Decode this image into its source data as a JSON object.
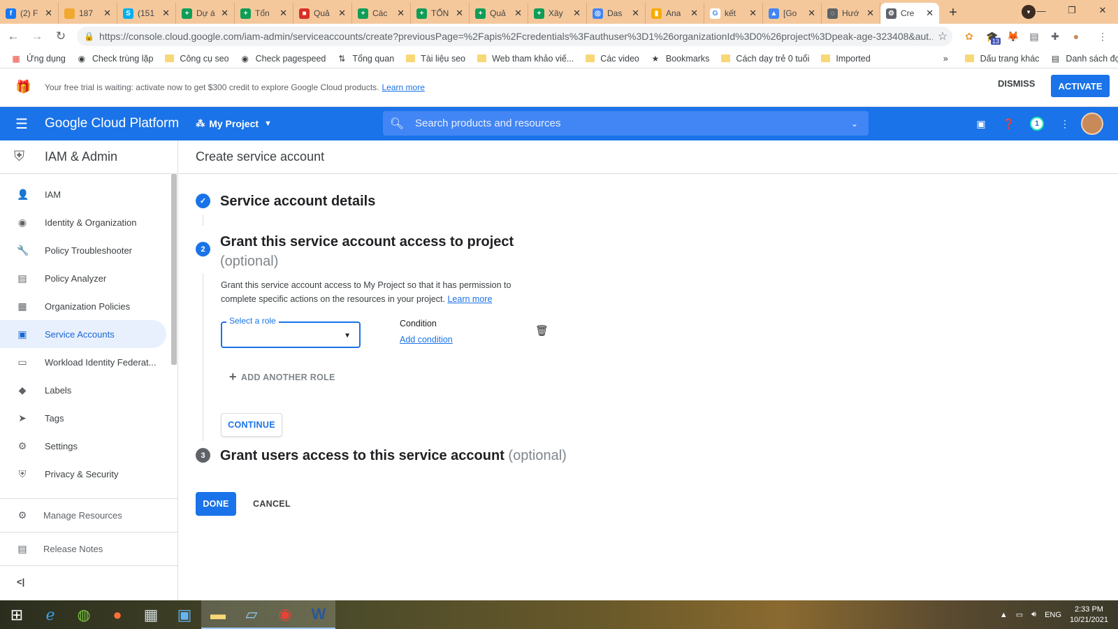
{
  "browser": {
    "tabs": [
      {
        "label": "(2) F",
        "icon": "facebook-icon",
        "color": "#1877f2",
        "glyph": "f"
      },
      {
        "label": "187",
        "icon": "tab-icon",
        "color": "#f0a830",
        "glyph": ""
      },
      {
        "label": "(151",
        "icon": "skype-icon",
        "color": "#00aff0",
        "glyph": "S"
      },
      {
        "label": "Dự á",
        "icon": "sheets-icon",
        "color": "#0f9d58",
        "glyph": "+"
      },
      {
        "label": "Tổn",
        "icon": "sheets-icon",
        "color": "#0f9d58",
        "glyph": "+"
      },
      {
        "label": "Quả",
        "icon": "slides-icon",
        "color": "#d93025",
        "glyph": "■"
      },
      {
        "label": "Các",
        "icon": "sheets-icon",
        "color": "#0f9d58",
        "glyph": "+"
      },
      {
        "label": "TỔN",
        "icon": "sheets-icon",
        "color": "#0f9d58",
        "glyph": "+"
      },
      {
        "label": "Quả",
        "icon": "sheets-icon",
        "color": "#0f9d58",
        "glyph": "+"
      },
      {
        "label": "Xây",
        "icon": "sheets-icon",
        "color": "#0f9d58",
        "glyph": "+"
      },
      {
        "label": "Das",
        "icon": "datastudio-icon",
        "color": "#4285f4",
        "glyph": "◎"
      },
      {
        "label": "Ana",
        "icon": "analytics-icon",
        "color": "#f9ab00",
        "glyph": "▮"
      },
      {
        "label": "kết",
        "icon": "google-icon",
        "color": "#ffffff",
        "glyph": "G"
      },
      {
        "label": "[Go",
        "icon": "drive-icon",
        "color": "#4285f4",
        "glyph": "▲"
      },
      {
        "label": "Hướ",
        "icon": "tab-icon",
        "color": "#5f6368",
        "glyph": "◌"
      },
      {
        "label": "Cre",
        "icon": "gcp-icon",
        "color": "#5f6368",
        "glyph": "⚙"
      }
    ],
    "url": "https://console.cloud.google.com/iam-admin/serviceaccounts/create?previousPage=%2Fapis%2Fcredentials%3Fauthuser%3D1%26organizationId%3D0%26project%3Dpeak-age-323408&aut...",
    "bookmarks": [
      {
        "label": "Ứng dụng",
        "icon": "apps-grid-icon"
      },
      {
        "label": "Check trùng lặp",
        "icon": "globe-icon"
      },
      {
        "label": "Công cụ seo",
        "icon": "folder-icon"
      },
      {
        "label": "Check pagespeed",
        "icon": "globe-icon"
      },
      {
        "label": "Tổng quan",
        "icon": "filter-icon"
      },
      {
        "label": "Tài liệu seo",
        "icon": "folder-icon"
      },
      {
        "label": "Web tham khảo viế...",
        "icon": "folder-icon"
      },
      {
        "label": "Các video",
        "icon": "folder-icon"
      },
      {
        "label": "Bookmarks",
        "icon": "star-icon"
      },
      {
        "label": "Cách dạy trẻ 0 tuổi",
        "icon": "folder-icon"
      },
      {
        "label": "Imported",
        "icon": "folder-icon"
      }
    ],
    "bookmarks_more": "»",
    "other_bookmarks": "Dấu trang khác",
    "reading_list": "Danh sách đọc",
    "ext_badge": "13"
  },
  "banner": {
    "text": "Your free trial is waiting: activate now to get $300 credit to explore Google Cloud products.",
    "link": "Learn more",
    "dismiss": "DISMISS",
    "activate": "ACTIVATE"
  },
  "header": {
    "title": "Google Cloud Platform",
    "project": "My Project",
    "search_placeholder": "Search products and resources",
    "notifications": "1"
  },
  "sidebar": {
    "title": "IAM & Admin",
    "items": [
      {
        "label": "IAM",
        "icon": "person-add-icon",
        "glyph": "👤"
      },
      {
        "label": "Identity & Organization",
        "icon": "account-circle-icon",
        "glyph": "◉"
      },
      {
        "label": "Policy Troubleshooter",
        "icon": "wrench-icon",
        "glyph": "🔧"
      },
      {
        "label": "Policy Analyzer",
        "icon": "document-search-icon",
        "glyph": "▤"
      },
      {
        "label": "Organization Policies",
        "icon": "list-icon",
        "glyph": "▦"
      },
      {
        "label": "Service Accounts",
        "icon": "service-account-icon",
        "glyph": "▣"
      },
      {
        "label": "Workload Identity Federat...",
        "icon": "id-card-icon",
        "glyph": "▭"
      },
      {
        "label": "Labels",
        "icon": "tag-icon",
        "glyph": "◆"
      },
      {
        "label": "Tags",
        "icon": "tag-arrow-icon",
        "glyph": "➤"
      },
      {
        "label": "Settings",
        "icon": "gear-icon",
        "glyph": "⚙"
      },
      {
        "label": "Privacy & Security",
        "icon": "shield-icon",
        "glyph": "⛨"
      }
    ],
    "footer": [
      {
        "label": "Manage Resources",
        "icon": "manage-resources-icon",
        "glyph": "⚙"
      },
      {
        "label": "Release Notes",
        "icon": "release-notes-icon",
        "glyph": "▤"
      }
    ],
    "collapse": "<|"
  },
  "main": {
    "page_title": "Create service account",
    "step1": {
      "title": "Service account details"
    },
    "step2": {
      "number": "2",
      "title": "Grant this service account access to project",
      "optional": "(optional)",
      "description": "Grant this service account access to My Project so that it has permission to complete specific actions on the resources in your project.",
      "learn_more": "Learn more",
      "role_label": "Select a role",
      "condition_label": "Condition",
      "add_condition": "Add condition",
      "add_another_role": "ADD ANOTHER ROLE",
      "continue": "CONTINUE"
    },
    "step3": {
      "number": "3",
      "title": "Grant users access to this service account",
      "optional": "(optional)"
    },
    "done": "DONE",
    "cancel": "CANCEL"
  },
  "taskbar": {
    "language": "ENG",
    "time": "2:33 PM",
    "date": "10/21/2021"
  }
}
